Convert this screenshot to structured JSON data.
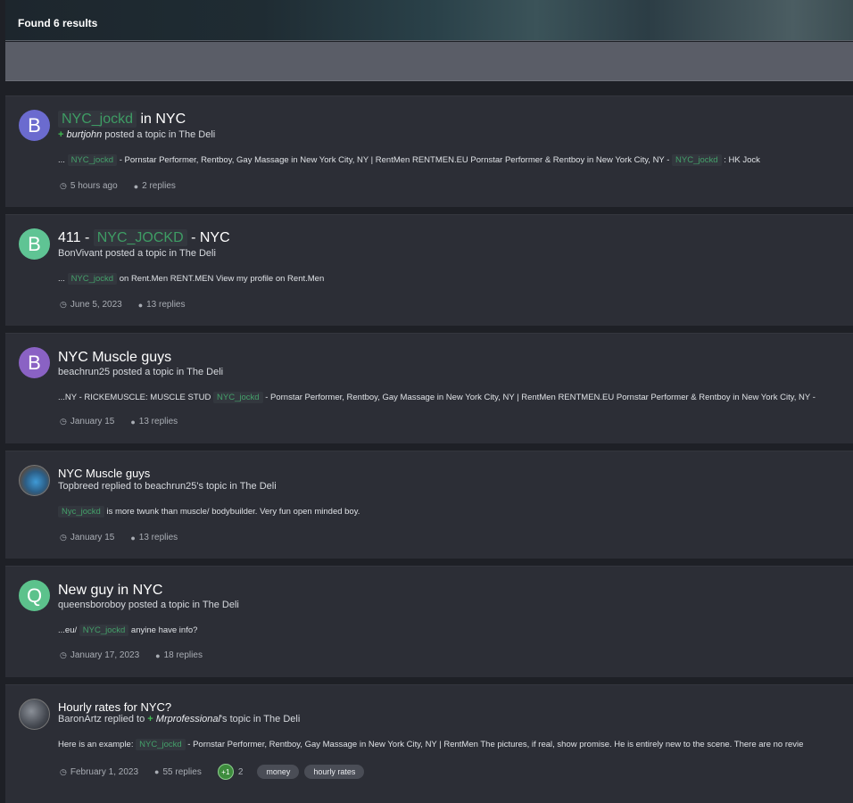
{
  "header": {
    "found_text": "Found 6 results"
  },
  "results": [
    {
      "avatar_letter": "B",
      "avatar_color": "#6b6bcf",
      "title_highlight": "NYC_jockd",
      "title_rest": " in NYC",
      "author": "burtjohn",
      "action": " posted a topic in The Deli",
      "snippet_pre": "...",
      "snippet_hl": "NYC_jockd",
      "snippet_mid": " - Pornstar Performer, Rentboy, Gay Massage in New York City, NY | RentMen RENTMEN.EU Pornstar Performer & Rentboy in New York City, NY - ",
      "snippet_hl2": "NYC_jockd",
      "snippet_post": " : HK Jock",
      "time": "5 hours ago",
      "replies": "2 replies"
    },
    {
      "avatar_letter": "B",
      "avatar_color": "#5fc494",
      "title_pre": "411 - ",
      "title_highlight": "NYC_JOCKD",
      "title_rest": " - NYC",
      "author": "BonVivant",
      "action": " posted a topic in The Deli",
      "snippet_pre": "...",
      "snippet_hl": "NYC_jockd",
      "snippet_post": " on Rent.Men RENT.MEN View my profile on Rent.Men",
      "time": "June 5, 2023",
      "replies": "13 replies"
    },
    {
      "avatar_letter": "B",
      "avatar_color": "#8a62c4",
      "title": "NYC Muscle guys",
      "author": "beachrun25",
      "action": " posted a topic in The Deli",
      "snippet_pre": "...NY - RICKEMUSCLE: MUSCLE STUD ",
      "snippet_hl": "NYC_jockd",
      "snippet_post": " - Pornstar Performer, Rentboy, Gay Massage in New York City, NY | RentMen RENTMEN.EU Pornstar Performer & Rentboy in New York City, NY -",
      "time": "January 15",
      "replies": "13 replies"
    },
    {
      "title": "NYC Muscle guys",
      "author": "Topbreed",
      "action": " replied to beachrun25's topic in The Deli",
      "snippet_hl": "Nyc_jockd",
      "snippet_post": " is more twunk than muscle/ bodybuilder. Very fun open minded boy.",
      "time": "January 15",
      "replies": "13 replies"
    },
    {
      "avatar_letter": "Q",
      "avatar_color": "#5cc28c",
      "title": "New guy in NYC",
      "author": "queensboroboy",
      "action": " posted a topic in The Deli",
      "snippet_pre": "...eu/ ",
      "snippet_hl": "NYC_jockd",
      "snippet_post": " anyine have info?",
      "time": "January 17, 2023",
      "replies": "18 replies"
    },
    {
      "title": "Hourly rates for NYC?",
      "author": "BaronArtz",
      "action_mid": " replied to ",
      "author2": "Mrprofessional",
      "action": "'s topic in The Deli",
      "snippet_pre": "Here is an example: ",
      "snippet_hl": "NYC_jockd",
      "snippet_post": " - Pornstar Performer, Rentboy, Gay Massage in New York City, NY | RentMen The pictures, if real, show promise. He is entirely new to the scene. There are no revie",
      "time": "February 1, 2023",
      "replies": "55 replies",
      "reputation_badge": "+1",
      "reputation_count": "2",
      "tags": [
        "money",
        "hourly rates"
      ]
    }
  ]
}
